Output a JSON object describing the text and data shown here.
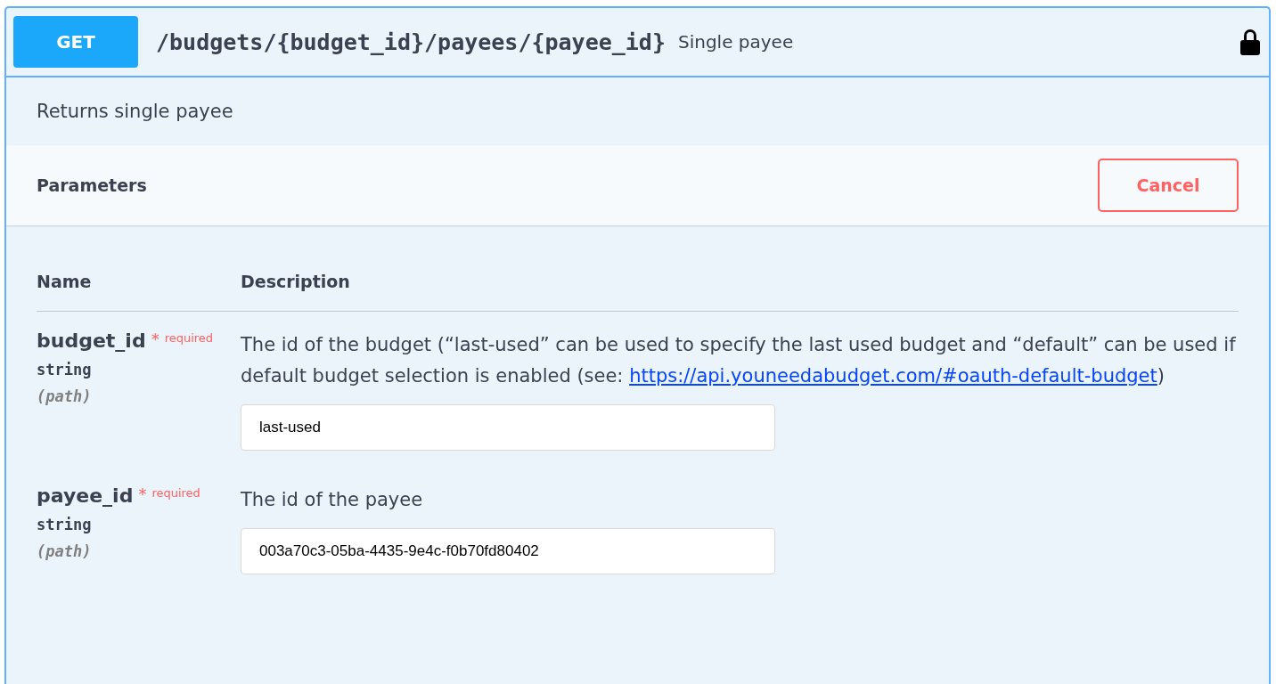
{
  "operation": {
    "method": "GET",
    "path": "/budgets/{budget_id}/payees/{payee_id}",
    "summary": "Single payee",
    "locked": true
  },
  "description": "Returns single payee",
  "parameters_section": {
    "title": "Parameters",
    "cancel_button": "Cancel"
  },
  "table": {
    "columns": [
      "Name",
      "Description"
    ],
    "rows": [
      {
        "name": "budget_id",
        "required_mark": "*",
        "required_label": "required",
        "type": "string",
        "location": "(path)",
        "description": {
          "text": "The id of the budget (“last-used” can be used to specify the last used budget and “default” can be used if default budget selection is enabled (see: ",
          "link": "https://api.youneedabudget.com/#oauth-default-budget",
          "after": ")"
        },
        "value": "last-used"
      },
      {
        "name": "payee_id",
        "required_mark": "*",
        "required_label": "required",
        "type": "string",
        "location": "(path)",
        "description": {
          "text": "The id of the payee"
        },
        "value": "003a70c3-05ba-4435-9e4c-f0b70fd80402"
      }
    ]
  }
}
